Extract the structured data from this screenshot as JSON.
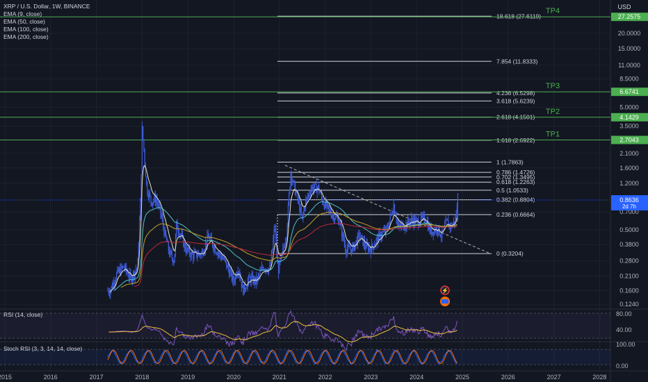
{
  "header": {
    "symbol_line": "XRP / U.S. Dollar, 1W, BINANCE",
    "currency": "USD",
    "indicators": [
      "EMA (9, close)",
      "EMA (50, close)",
      "EMA (100, close)",
      "EMA (200, close)"
    ]
  },
  "colors": {
    "background": "#131722",
    "grid": "#1e222d",
    "candle": "#3d5bd9",
    "tp_line": "#4caf50",
    "tp_label": "#4caf50",
    "fib_line": "#d1d4dc",
    "ema9": "#e8e6c4",
    "ema50": "#4fc3c8",
    "ema100": "#c9a227",
    "ema200": "#c1273a",
    "rsi_line": "#7e57c2",
    "rsi_ma": "#f0c23a",
    "stoch_k": "#2962ff",
    "stoch_d": "#ff6d00",
    "current_price_bg": "#2962ff"
  },
  "price_axis": {
    "ticks": [
      "20.0000",
      "15.0000",
      "11.0000",
      "8.5000",
      "5.0000",
      "3.5000",
      "2.1000",
      "1.6000",
      "1.2000",
      "0.7000",
      "0.5000",
      "0.3800",
      "0.2800",
      "0.2100",
      "0.1600",
      "0.1240"
    ],
    "current_price": "0.8636",
    "countdown": "2d 7h"
  },
  "tp_levels": [
    {
      "name": "TP4",
      "price": "27.2575"
    },
    {
      "name": "TP3",
      "price": "6.6741"
    },
    {
      "name": "TP2",
      "price": "4.1429"
    },
    {
      "name": "TP1",
      "price": "2.7043"
    }
  ],
  "fib_levels": [
    {
      "label": "18.618 (27.6119)"
    },
    {
      "label": "7.854 (11.8333)"
    },
    {
      "label": "4.236 (6.5298)"
    },
    {
      "label": "3.618 (5.6239)"
    },
    {
      "label": "2.618 (4.1501)"
    },
    {
      "label": "1.618 (2.6922)"
    },
    {
      "label": "1 (1.7863)"
    },
    {
      "label": "0.786 (1.4726)"
    },
    {
      "label": "0.702 (1.3495)"
    },
    {
      "label": "0.618 (1.2263)"
    },
    {
      "label": "0.5 (1.0533)"
    },
    {
      "label": "0.382 (0.8804)"
    },
    {
      "label": "0.236 (0.6664)"
    },
    {
      "label": "0 (0.3204)"
    }
  ],
  "rsi": {
    "title": "RSI (14, close)",
    "ticks": [
      "80.00",
      "40.00"
    ]
  },
  "stoch_rsi": {
    "title": "Stoch RSI (3, 3, 14, 14, close)",
    "ticks": [
      "100.00",
      "0.00"
    ]
  },
  "time_axis": {
    "labels": [
      "2015",
      "2016",
      "2017",
      "2018",
      "2019",
      "2020",
      "2021",
      "2022",
      "2023",
      "2024",
      "2025",
      "2026",
      "2027",
      "2028"
    ]
  },
  "chart_data": {
    "type": "candlestick",
    "title": "XRP / U.S. Dollar, 1W, BINANCE",
    "scale": "log",
    "ylim": [
      0.115,
      32
    ],
    "price_path": [
      [
        2017.3,
        0.16
      ],
      [
        2017.45,
        0.22
      ],
      [
        2017.6,
        0.25
      ],
      [
        2017.75,
        0.2
      ],
      [
        2017.9,
        0.25
      ],
      [
        2017.97,
        1.0
      ],
      [
        2018.0,
        3.3
      ],
      [
        2018.05,
        2.0
      ],
      [
        2018.1,
        1.1
      ],
      [
        2018.2,
        0.85
      ],
      [
        2018.3,
        0.9
      ],
      [
        2018.4,
        0.7
      ],
      [
        2018.5,
        0.45
      ],
      [
        2018.6,
        0.32
      ],
      [
        2018.7,
        0.28
      ],
      [
        2018.75,
        0.55
      ],
      [
        2018.85,
        0.45
      ],
      [
        2018.95,
        0.35
      ],
      [
        2019.1,
        0.31
      ],
      [
        2019.3,
        0.32
      ],
      [
        2019.45,
        0.44
      ],
      [
        2019.6,
        0.35
      ],
      [
        2019.8,
        0.28
      ],
      [
        2020.0,
        0.19
      ],
      [
        2020.1,
        0.25
      ],
      [
        2020.2,
        0.16
      ],
      [
        2020.35,
        0.2
      ],
      [
        2020.5,
        0.19
      ],
      [
        2020.65,
        0.25
      ],
      [
        2020.8,
        0.24
      ],
      [
        2020.9,
        0.55
      ],
      [
        2020.97,
        0.23
      ],
      [
        2021.05,
        0.3
      ],
      [
        2021.15,
        0.45
      ],
      [
        2021.25,
        1.5
      ],
      [
        2021.3,
        1.2
      ],
      [
        2021.4,
        0.9
      ],
      [
        2021.5,
        0.6
      ],
      [
        2021.55,
        0.8
      ],
      [
        2021.7,
        1.1
      ],
      [
        2021.85,
        1.1
      ],
      [
        2021.95,
        0.85
      ],
      [
        2022.1,
        0.7
      ],
      [
        2022.3,
        0.6
      ],
      [
        2022.45,
        0.35
      ],
      [
        2022.6,
        0.35
      ],
      [
        2022.75,
        0.45
      ],
      [
        2022.9,
        0.36
      ],
      [
        2023.0,
        0.35
      ],
      [
        2023.2,
        0.45
      ],
      [
        2023.35,
        0.5
      ],
      [
        2023.5,
        0.8
      ],
      [
        2023.6,
        0.52
      ],
      [
        2023.75,
        0.55
      ],
      [
        2023.9,
        0.6
      ],
      [
        2024.0,
        0.58
      ],
      [
        2024.2,
        0.62
      ],
      [
        2024.3,
        0.48
      ],
      [
        2024.45,
        0.52
      ],
      [
        2024.55,
        0.45
      ],
      [
        2024.65,
        0.58
      ],
      [
        2024.75,
        0.53
      ],
      [
        2024.85,
        0.6
      ],
      [
        2024.9,
        0.8636
      ]
    ],
    "x_range": [
      "2015",
      "2028"
    ]
  }
}
